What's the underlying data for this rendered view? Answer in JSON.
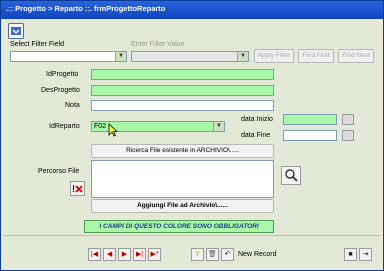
{
  "window": {
    "title": ".:: Progetto > Reparto ::.   frmProgettoReparto"
  },
  "filter": {
    "select_label": "Select Filter Field",
    "enter_label": "Enter Filter Value",
    "apply_label": "Apply Filter",
    "find_first_label": "Find First",
    "find_next_label": "Find Next"
  },
  "form": {
    "id_progetto_label": "IdProgetto",
    "des_progetto_label": "DesProgetto",
    "nota_label": "Nota",
    "id_reparto_label": "IdReparto",
    "id_reparto_value": "F02",
    "data_inizio_label": "data Inizio",
    "data_fine_label": "data Fine",
    "ricerca_button": "Ricerca File esistente in ARCHIVIO\\.....",
    "percorso_label": "Percorso File",
    "aggiungi_button": "Aggiungi File ad Archivio\\......"
  },
  "notice": "I CAMPI DI QUESTO COLORE SONO OBBLIGATORI",
  "navigation": {
    "new_record_label": "New Record"
  },
  "colors": {
    "required": "#a9f7a9",
    "title_bar": "#1450c8",
    "form_bg": "#e2ead7"
  },
  "icons": [
    "app-logo-icon",
    "clear-path-icon",
    "search-magnifier-icon",
    "first-record-icon",
    "prev-record-icon",
    "next-record-icon",
    "last-record-icon",
    "new-record-icon",
    "filter-icon",
    "delete-icon",
    "undo-icon",
    "save-icon",
    "exit-icon",
    "calendar-icon"
  ]
}
